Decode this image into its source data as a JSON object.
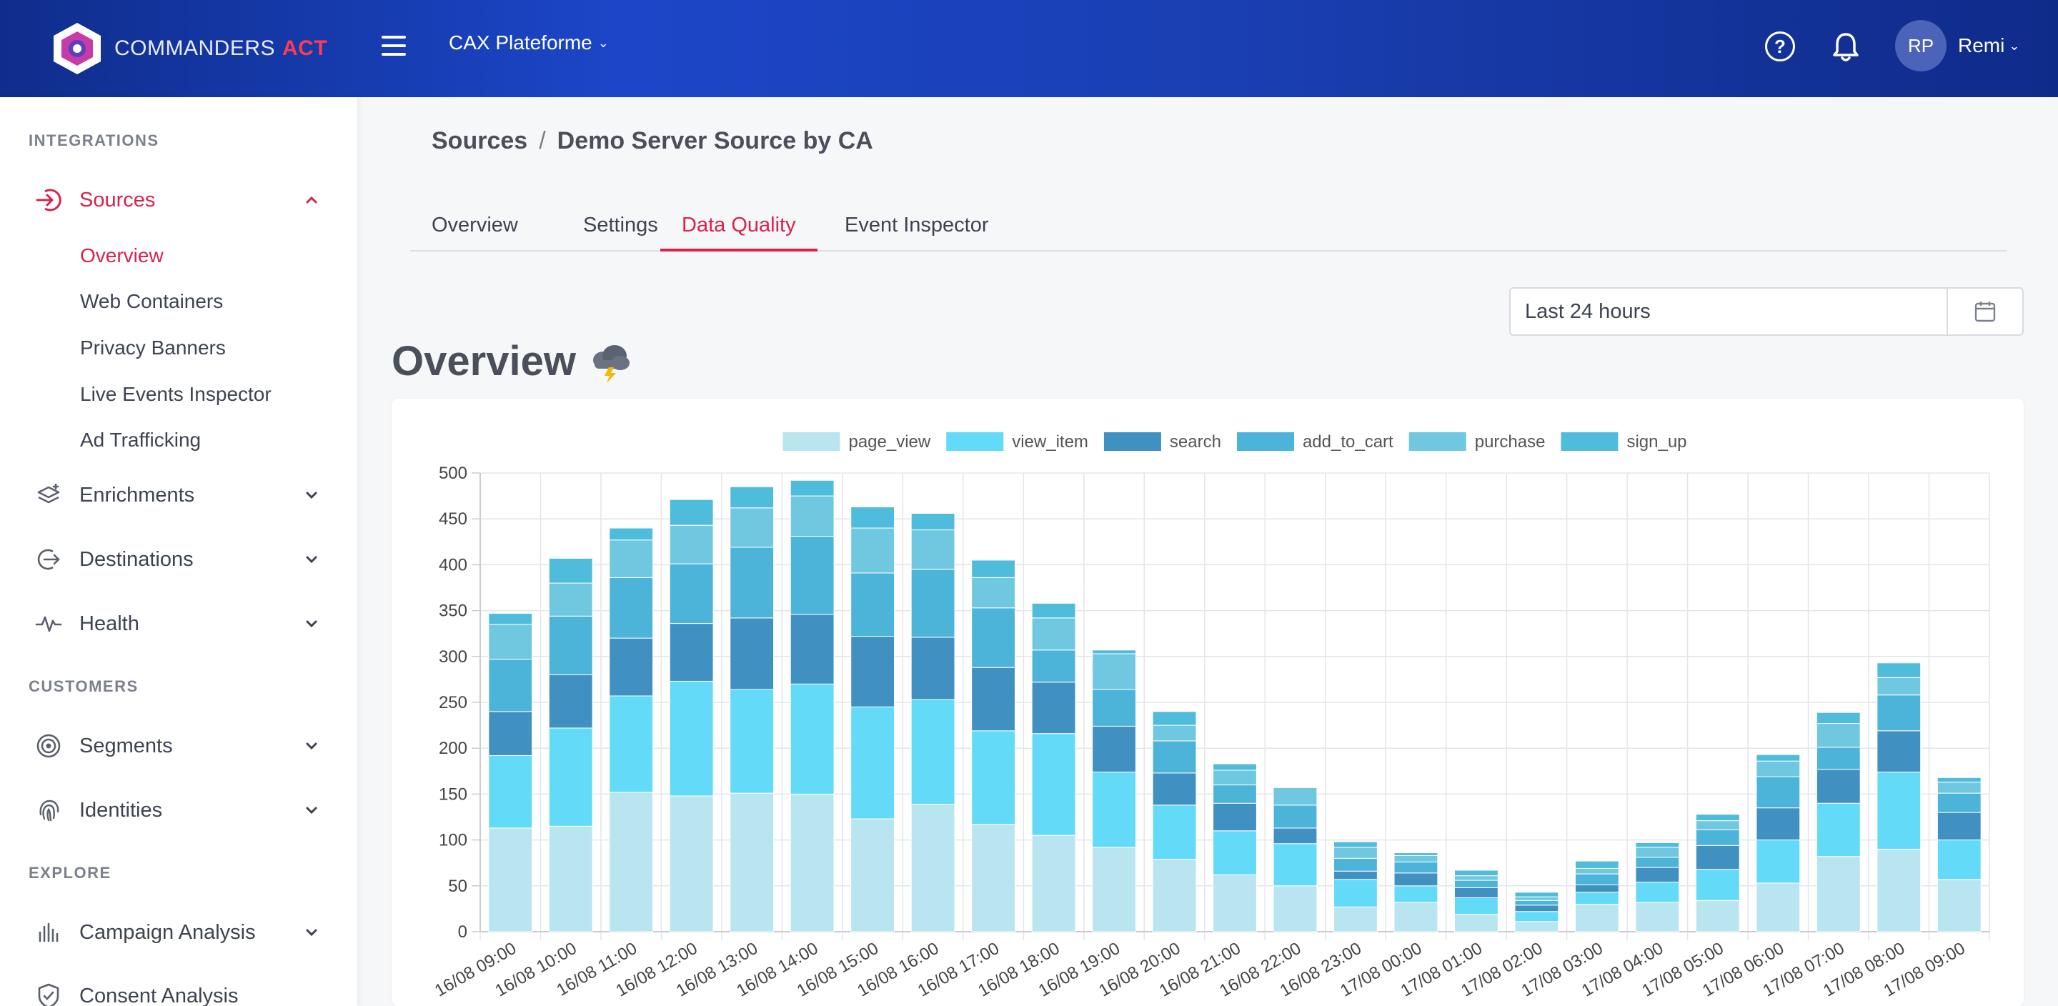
{
  "app": {
    "brand_main": "COMMANDERS",
    "brand_accent": "ACT",
    "platform": "CAX Plateforme",
    "user_initials": "RP",
    "user_name": "Remi"
  },
  "sidebar": {
    "sections": {
      "integrations": "INTEGRATIONS",
      "customers": "CUSTOMERS",
      "explore": "EXPLORE"
    },
    "sources": {
      "label": "Sources",
      "sub_items": [
        "Overview",
        "Web Containers",
        "Privacy Banners",
        "Live Events Inspector",
        "Ad Trafficking"
      ]
    },
    "items": {
      "enrichments": "Enrichments",
      "destinations": "Destinations",
      "health": "Health",
      "segments": "Segments",
      "identities": "Identities",
      "campaign_analysis": "Campaign Analysis",
      "consent_analysis": "Consent Analysis"
    }
  },
  "main": {
    "breadcrumb": [
      "Sources",
      "/",
      "Demo Server Source by CA"
    ],
    "tabs": [
      "Overview",
      "Settings",
      "Data Quality",
      "Event Inspector"
    ],
    "active_tab": "Data Quality",
    "date_range": "Last 24 hours",
    "section_title": "Overview",
    "weather_icon": "storm-cloud-icon"
  },
  "colors": {
    "brand_red": "#d7234d",
    "topbar": "#1c46c8"
  },
  "chart_data": {
    "type": "bar",
    "stacked": true,
    "grid": true,
    "legend_position": "top",
    "ylim": [
      0,
      500
    ],
    "yticks": [
      0,
      50,
      100,
      150,
      200,
      250,
      300,
      350,
      400,
      450,
      500
    ],
    "categories": [
      "16/08 09:00",
      "16/08 10:00",
      "16/08 11:00",
      "16/08 12:00",
      "16/08 13:00",
      "16/08 14:00",
      "16/08 15:00",
      "16/08 16:00",
      "16/08 17:00",
      "16/08 18:00",
      "16/08 19:00",
      "16/08 20:00",
      "16/08 21:00",
      "16/08 22:00",
      "16/08 23:00",
      "17/08 00:00",
      "17/08 01:00",
      "17/08 02:00",
      "17/08 03:00",
      "17/08 04:00",
      "17/08 05:00",
      "17/08 06:00",
      "17/08 07:00",
      "17/08 08:00",
      "17/08 09:00"
    ],
    "series": [
      {
        "name": "page_view",
        "color": "#b9e5f0",
        "values": [
          113,
          115,
          152,
          148,
          151,
          150,
          123,
          139,
          117,
          105,
          92,
          79,
          62,
          50,
          27,
          32,
          19,
          11,
          30,
          32,
          34,
          53,
          82,
          90,
          57
        ]
      },
      {
        "name": "view_item",
        "color": "#62daf8",
        "values": [
          79,
          107,
          105,
          125,
          113,
          120,
          122,
          114,
          102,
          111,
          82,
          59,
          48,
          46,
          30,
          18,
          18,
          11,
          13,
          22,
          34,
          47,
          58,
          84,
          43
        ]
      },
      {
        "name": "search",
        "color": "#4090c2",
        "values": [
          48,
          58,
          63,
          63,
          78,
          76,
          77,
          68,
          69,
          56,
          50,
          35,
          30,
          17,
          9,
          14,
          11,
          7,
          8,
          16,
          26,
          35,
          37,
          45,
          30
        ]
      },
      {
        "name": "add_to_cart",
        "color": "#4cb3d9",
        "values": [
          57,
          64,
          66,
          65,
          77,
          85,
          69,
          74,
          65,
          35,
          40,
          35,
          20,
          25,
          14,
          12,
          8,
          5,
          12,
          11,
          17,
          34,
          24,
          39,
          21
        ]
      },
      {
        "name": "purchase",
        "color": "#6fc8e0",
        "values": [
          38,
          36,
          41,
          42,
          43,
          44,
          49,
          43,
          33,
          35,
          39,
          17,
          16,
          19,
          12,
          7,
          5,
          4,
          6,
          11,
          10,
          17,
          26,
          19,
          12
        ]
      },
      {
        "name": "sign_up",
        "color": "#4fbcdc",
        "values": [
          12,
          27,
          13,
          28,
          23,
          17,
          23,
          18,
          19,
          16,
          4,
          15,
          7,
          0,
          6,
          3,
          6,
          5,
          8,
          5,
          7,
          7,
          12,
          16,
          5
        ]
      }
    ]
  }
}
